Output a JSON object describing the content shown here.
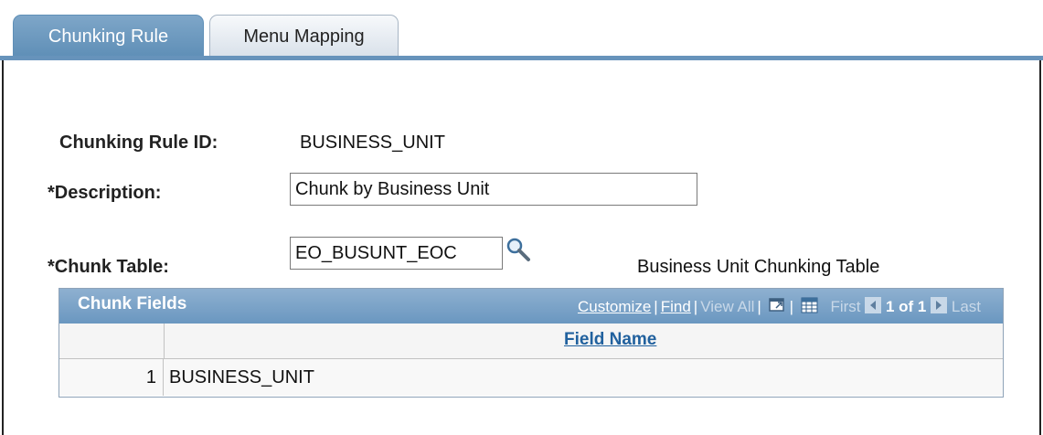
{
  "tabs": [
    {
      "label": "Chunking Rule",
      "active": true
    },
    {
      "label": "Menu Mapping",
      "active": false
    }
  ],
  "form": {
    "rule_id_label": "Chunking Rule ID:",
    "rule_id_value": "BUSINESS_UNIT",
    "description_label": "*Description:",
    "description_value": "Chunk by Business Unit",
    "chunk_table_label": "*Chunk Table:",
    "chunk_table_value": "EO_BUSUNT_EOC",
    "chunk_table_desc": "Business Unit Chunking Table",
    "lookup_icon": "magnifier-icon"
  },
  "grid": {
    "title": "Chunk Fields",
    "customize": "Customize",
    "find": "Find",
    "view_all": "View All",
    "first": "First",
    "pager": "1 of 1",
    "last": "Last",
    "column_header": "Field Name",
    "rows": [
      {
        "num": "1",
        "field": "BUSINESS_UNIT"
      }
    ]
  },
  "colors": {
    "accent": "#6793bb",
    "link": "#21619e"
  }
}
